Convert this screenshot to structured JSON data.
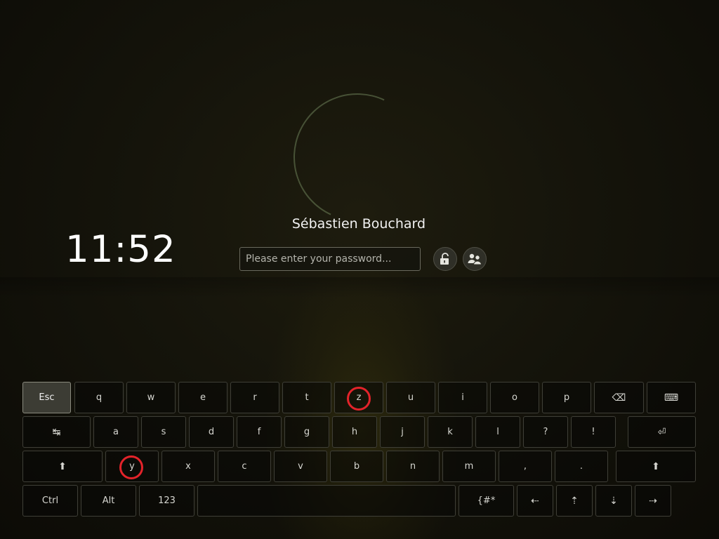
{
  "clock": {
    "time": "11:52"
  },
  "user": {
    "name": "Sébastien Bouchard"
  },
  "password": {
    "placeholder": "Please enter your password...",
    "value": ""
  },
  "buttons": {
    "unlock_icon": "unlock-icon",
    "switch_user_icon": "switch-user-icon"
  },
  "keyboard": {
    "row1": [
      "Esc",
      "q",
      "w",
      "e",
      "r",
      "t",
      "z",
      "u",
      "i",
      "o",
      "p",
      "⌫",
      "⌨"
    ],
    "row2": [
      "↹",
      "a",
      "s",
      "d",
      "f",
      "g",
      "h",
      "j",
      "k",
      "l",
      "?",
      "!",
      "⏎"
    ],
    "row3": [
      "⬆",
      "y",
      "x",
      "c",
      "v",
      "b",
      "n",
      "m",
      ",",
      ".",
      "⬆"
    ],
    "row4": [
      "Ctrl",
      "Alt",
      "123",
      "",
      "{#*",
      "⇠",
      "⇡",
      "⇣",
      "⇢"
    ]
  },
  "annotations": {
    "color": "#e3232a",
    "circled_keys": [
      "z",
      "y"
    ]
  }
}
